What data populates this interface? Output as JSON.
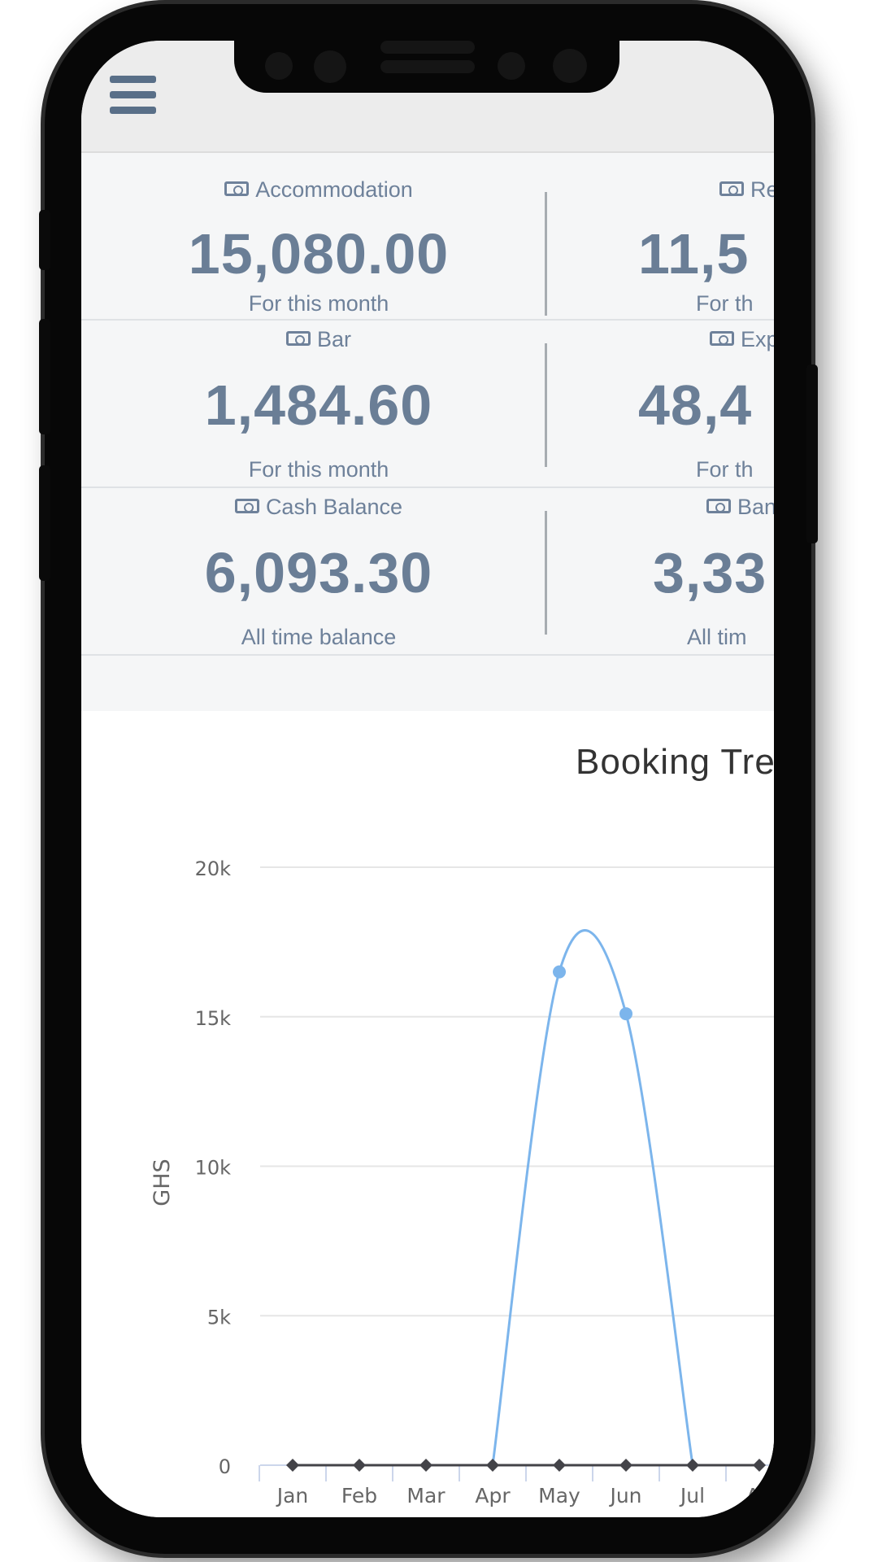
{
  "header": {
    "menu_icon": "hamburger-icon"
  },
  "stats": [
    {
      "label": "Accommodation",
      "value": "15,080.00",
      "sub": "For this month"
    },
    {
      "label": "Re",
      "value": "11,5",
      "sub": "For th"
    },
    {
      "label": "Bar",
      "value": "1,484.60",
      "sub": "For this month"
    },
    {
      "label": "Exp",
      "value": "48,4",
      "sub": "For th"
    },
    {
      "label": "Cash Balance",
      "value": "6,093.30",
      "sub": "All time balance"
    },
    {
      "label": "Ban",
      "value": "3,33",
      "sub": "All tim"
    }
  ],
  "chart_data": {
    "type": "line",
    "title": "Booking Tre",
    "ylabel": "GHS",
    "ylim": [
      0,
      20000
    ],
    "y_ticks": [
      "0",
      "5k",
      "10k",
      "15k",
      "20k"
    ],
    "categories": [
      "Jan",
      "Feb",
      "Mar",
      "Apr",
      "May",
      "Jun",
      "Jul",
      "Aug"
    ],
    "category_labels": [
      "Jan",
      "Feb",
      "Mar",
      "Apr",
      "May",
      "Jun",
      "Jul",
      "Au"
    ],
    "series": [
      {
        "values": [
          null,
          null,
          null,
          0,
          16500,
          15100,
          0,
          null
        ],
        "color": "#7cb5ec"
      },
      {
        "values": [
          0,
          0,
          0,
          0,
          0,
          0,
          0,
          0
        ],
        "color": "#434348"
      }
    ]
  },
  "colors": {
    "stat_text": "#6e819a",
    "line_blue": "#7cb5ec",
    "line_dark": "#434348",
    "topbar": "#ececec"
  }
}
